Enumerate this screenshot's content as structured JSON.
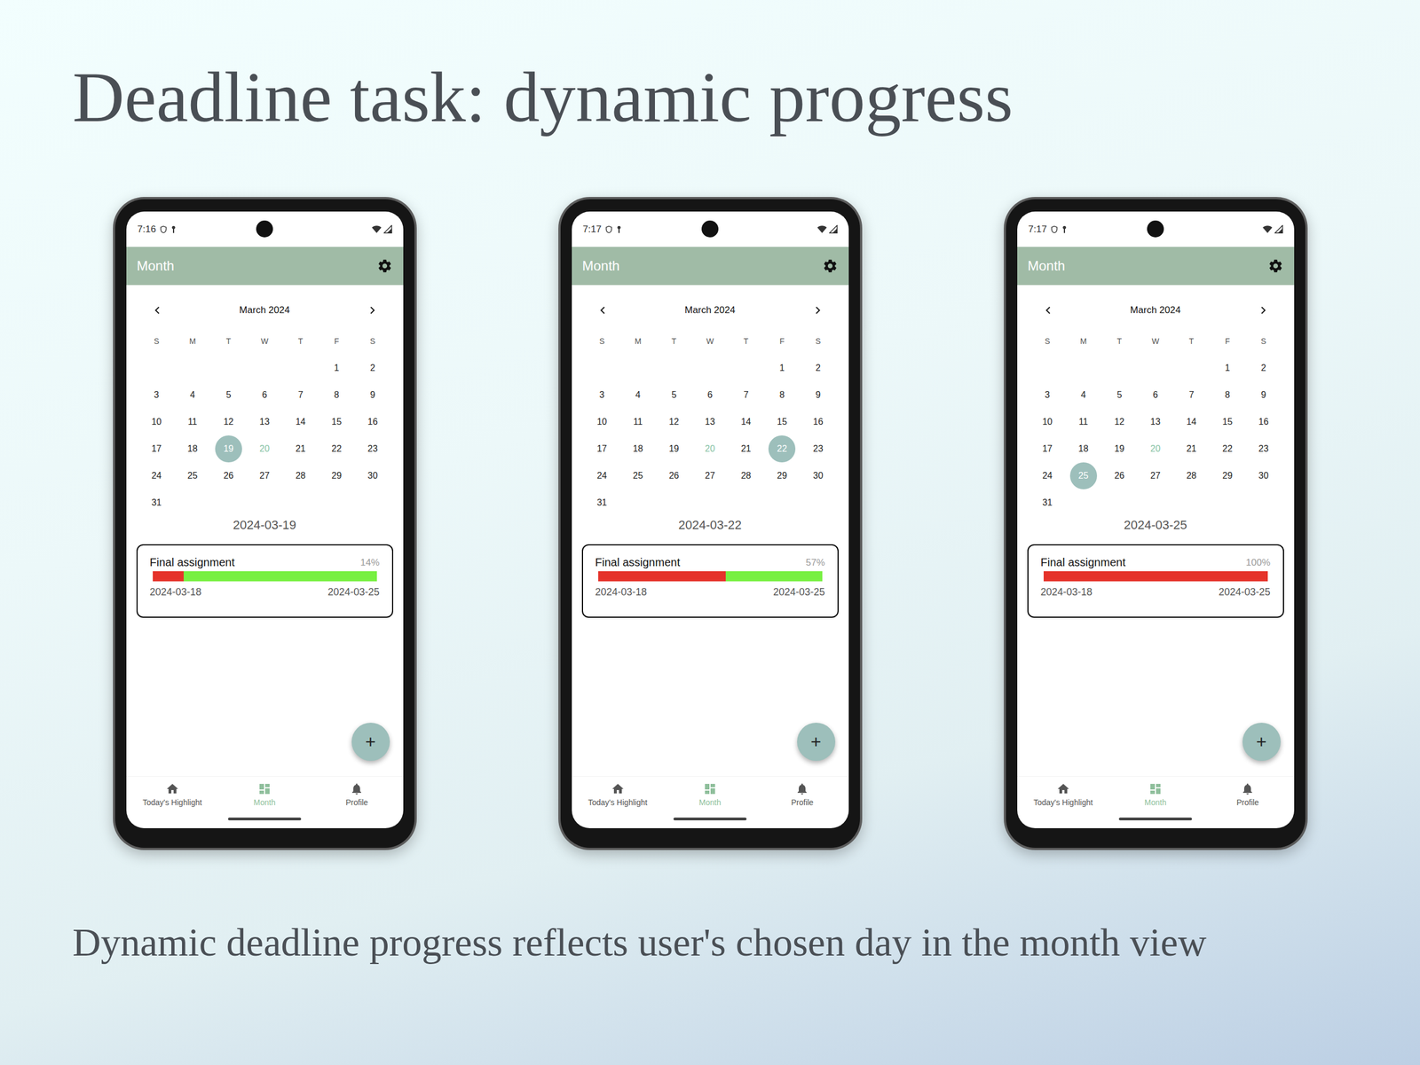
{
  "slide": {
    "title": "Deadline task: dynamic progress",
    "caption": "Dynamic deadline progress reflects user's chosen day in the month view"
  },
  "phones": [
    {
      "time": "7:16",
      "app_bar": {
        "title": "Month"
      },
      "calendar": {
        "month": "March 2024",
        "weekdays": [
          "S",
          "M",
          "T",
          "W",
          "T",
          "F",
          "S"
        ],
        "days": [
          {
            "day": "",
            "selected": false,
            "today": false
          },
          {
            "day": "",
            "selected": false,
            "today": false
          },
          {
            "day": "",
            "selected": false,
            "today": false
          },
          {
            "day": "",
            "selected": false,
            "today": false
          },
          {
            "day": "",
            "selected": false,
            "today": false
          },
          {
            "day": "1",
            "selected": false,
            "today": false
          },
          {
            "day": "2",
            "selected": false,
            "today": false
          },
          {
            "day": "3",
            "selected": false,
            "today": false
          },
          {
            "day": "4",
            "selected": false,
            "today": false
          },
          {
            "day": "5",
            "selected": false,
            "today": false
          },
          {
            "day": "6",
            "selected": false,
            "today": false
          },
          {
            "day": "7",
            "selected": false,
            "today": false
          },
          {
            "day": "8",
            "selected": false,
            "today": false
          },
          {
            "day": "9",
            "selected": false,
            "today": false
          },
          {
            "day": "10",
            "selected": false,
            "today": false
          },
          {
            "day": "11",
            "selected": false,
            "today": false
          },
          {
            "day": "12",
            "selected": false,
            "today": false
          },
          {
            "day": "13",
            "selected": false,
            "today": false
          },
          {
            "day": "14",
            "selected": false,
            "today": false
          },
          {
            "day": "15",
            "selected": false,
            "today": false
          },
          {
            "day": "16",
            "selected": false,
            "today": false
          },
          {
            "day": "17",
            "selected": false,
            "today": false
          },
          {
            "day": "18",
            "selected": false,
            "today": false
          },
          {
            "day": "19",
            "selected": true,
            "today": false
          },
          {
            "day": "20",
            "selected": false,
            "today": true
          },
          {
            "day": "21",
            "selected": false,
            "today": false
          },
          {
            "day": "22",
            "selected": false,
            "today": false
          },
          {
            "day": "23",
            "selected": false,
            "today": false
          },
          {
            "day": "24",
            "selected": false,
            "today": false
          },
          {
            "day": "25",
            "selected": false,
            "today": false
          },
          {
            "day": "26",
            "selected": false,
            "today": false
          },
          {
            "day": "27",
            "selected": false,
            "today": false
          },
          {
            "day": "28",
            "selected": false,
            "today": false
          },
          {
            "day": "29",
            "selected": false,
            "today": false
          },
          {
            "day": "30",
            "selected": false,
            "today": false
          },
          {
            "day": "31",
            "selected": false,
            "today": false
          }
        ]
      },
      "date_label": "2024-03-19",
      "tasks": [
        {
          "name": "Final assignment",
          "percent": "14%",
          "level": 0.14,
          "start": "2024-03-18",
          "end": "2024-03-25"
        }
      ],
      "fab": "+",
      "nav": [
        {
          "label": "Today's Highlight",
          "selected": false
        },
        {
          "label": "Month",
          "selected": true
        },
        {
          "label": "Profile",
          "selected": false
        }
      ]
    },
    {
      "time": "7:17",
      "app_bar": {
        "title": "Month"
      },
      "calendar": {
        "month": "March 2024",
        "weekdays": [
          "S",
          "M",
          "T",
          "W",
          "T",
          "F",
          "S"
        ],
        "days": [
          {
            "day": "",
            "selected": false,
            "today": false
          },
          {
            "day": "",
            "selected": false,
            "today": false
          },
          {
            "day": "",
            "selected": false,
            "today": false
          },
          {
            "day": "",
            "selected": false,
            "today": false
          },
          {
            "day": "",
            "selected": false,
            "today": false
          },
          {
            "day": "1",
            "selected": false,
            "today": false
          },
          {
            "day": "2",
            "selected": false,
            "today": false
          },
          {
            "day": "3",
            "selected": false,
            "today": false
          },
          {
            "day": "4",
            "selected": false,
            "today": false
          },
          {
            "day": "5",
            "selected": false,
            "today": false
          },
          {
            "day": "6",
            "selected": false,
            "today": false
          },
          {
            "day": "7",
            "selected": false,
            "today": false
          },
          {
            "day": "8",
            "selected": false,
            "today": false
          },
          {
            "day": "9",
            "selected": false,
            "today": false
          },
          {
            "day": "10",
            "selected": false,
            "today": false
          },
          {
            "day": "11",
            "selected": false,
            "today": false
          },
          {
            "day": "12",
            "selected": false,
            "today": false
          },
          {
            "day": "13",
            "selected": false,
            "today": false
          },
          {
            "day": "14",
            "selected": false,
            "today": false
          },
          {
            "day": "15",
            "selected": false,
            "today": false
          },
          {
            "day": "16",
            "selected": false,
            "today": false
          },
          {
            "day": "17",
            "selected": false,
            "today": false
          },
          {
            "day": "18",
            "selected": false,
            "today": false
          },
          {
            "day": "19",
            "selected": false,
            "today": false
          },
          {
            "day": "20",
            "selected": false,
            "today": true
          },
          {
            "day": "21",
            "selected": false,
            "today": false
          },
          {
            "day": "22",
            "selected": true,
            "today": false
          },
          {
            "day": "23",
            "selected": false,
            "today": false
          },
          {
            "day": "24",
            "selected": false,
            "today": false
          },
          {
            "day": "25",
            "selected": false,
            "today": false
          },
          {
            "day": "26",
            "selected": false,
            "today": false
          },
          {
            "day": "27",
            "selected": false,
            "today": false
          },
          {
            "day": "28",
            "selected": false,
            "today": false
          },
          {
            "day": "29",
            "selected": false,
            "today": false
          },
          {
            "day": "30",
            "selected": false,
            "today": false
          },
          {
            "day": "31",
            "selected": false,
            "today": false
          }
        ]
      },
      "date_label": "2024-03-22",
      "tasks": [
        {
          "name": "Final assignment",
          "percent": "57%",
          "level": 0.57,
          "start": "2024-03-18",
          "end": "2024-03-25"
        }
      ],
      "fab": "+",
      "nav": [
        {
          "label": "Today's Highlight",
          "selected": false
        },
        {
          "label": "Month",
          "selected": true
        },
        {
          "label": "Profile",
          "selected": false
        }
      ]
    },
    {
      "time": "7:17",
      "app_bar": {
        "title": "Month"
      },
      "calendar": {
        "month": "March 2024",
        "weekdays": [
          "S",
          "M",
          "T",
          "W",
          "T",
          "F",
          "S"
        ],
        "days": [
          {
            "day": "",
            "selected": false,
            "today": false
          },
          {
            "day": "",
            "selected": false,
            "today": false
          },
          {
            "day": "",
            "selected": false,
            "today": false
          },
          {
            "day": "",
            "selected": false,
            "today": false
          },
          {
            "day": "",
            "selected": false,
            "today": false
          },
          {
            "day": "1",
            "selected": false,
            "today": false
          },
          {
            "day": "2",
            "selected": false,
            "today": false
          },
          {
            "day": "3",
            "selected": false,
            "today": false
          },
          {
            "day": "4",
            "selected": false,
            "today": false
          },
          {
            "day": "5",
            "selected": false,
            "today": false
          },
          {
            "day": "6",
            "selected": false,
            "today": false
          },
          {
            "day": "7",
            "selected": false,
            "today": false
          },
          {
            "day": "8",
            "selected": false,
            "today": false
          },
          {
            "day": "9",
            "selected": false,
            "today": false
          },
          {
            "day": "10",
            "selected": false,
            "today": false
          },
          {
            "day": "11",
            "selected": false,
            "today": false
          },
          {
            "day": "12",
            "selected": false,
            "today": false
          },
          {
            "day": "13",
            "selected": false,
            "today": false
          },
          {
            "day": "14",
            "selected": false,
            "today": false
          },
          {
            "day": "15",
            "selected": false,
            "today": false
          },
          {
            "day": "16",
            "selected": false,
            "today": false
          },
          {
            "day": "17",
            "selected": false,
            "today": false
          },
          {
            "day": "18",
            "selected": false,
            "today": false
          },
          {
            "day": "19",
            "selected": false,
            "today": false
          },
          {
            "day": "20",
            "selected": false,
            "today": true
          },
          {
            "day": "21",
            "selected": false,
            "today": false
          },
          {
            "day": "22",
            "selected": false,
            "today": false
          },
          {
            "day": "23",
            "selected": false,
            "today": false
          },
          {
            "day": "24",
            "selected": false,
            "today": false
          },
          {
            "day": "25",
            "selected": true,
            "today": false
          },
          {
            "day": "26",
            "selected": false,
            "today": false
          },
          {
            "day": "27",
            "selected": false,
            "today": false
          },
          {
            "day": "28",
            "selected": false,
            "today": false
          },
          {
            "day": "29",
            "selected": false,
            "today": false
          },
          {
            "day": "30",
            "selected": false,
            "today": false
          },
          {
            "day": "31",
            "selected": false,
            "today": false
          }
        ]
      },
      "date_label": "2024-03-25",
      "tasks": [
        {
          "name": "Final assignment",
          "percent": "100%",
          "level": 1,
          "start": "2024-03-18",
          "end": "2024-03-25"
        }
      ],
      "fab": "+",
      "nav": [
        {
          "label": "Today's Highlight",
          "selected": false
        },
        {
          "label": "Month",
          "selected": true
        },
        {
          "label": "Profile",
          "selected": false
        }
      ]
    }
  ]
}
